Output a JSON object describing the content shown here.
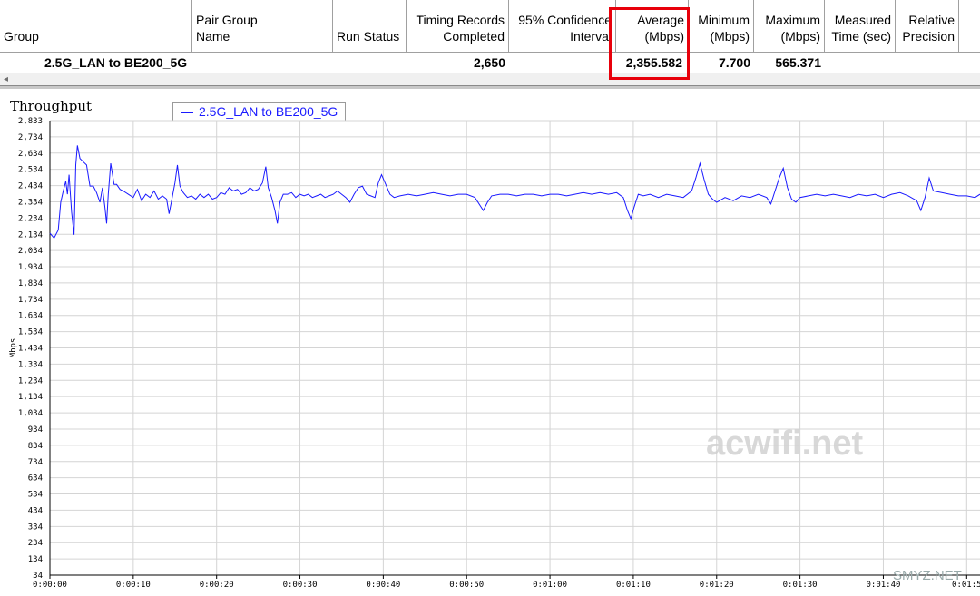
{
  "table": {
    "headers": {
      "group": "Group",
      "pair_group_name": "Pair Group\nName",
      "run_status": "Run Status",
      "timing_records": "Timing Records\nCompleted",
      "confidence": "95% Confidence\nInterval",
      "average": "Average\n(Mbps)",
      "minimum": "Minimum\n(Mbps)",
      "maximum": "Maximum\n(Mbps)",
      "measured_time": "Measured\nTime (sec)",
      "relative_precision": "Relative\nPrecision"
    },
    "row": {
      "group_name": "2.5G_LAN to BE200_5G",
      "timing_records": "2,650",
      "average": "2,355.582",
      "minimum": "7.700",
      "maximum": "565.371"
    },
    "scroll_arrow": "◂"
  },
  "chart_title": "Throughput",
  "legend_label": "2.5G_LAN to BE200_5G",
  "watermark": "acwifi.net",
  "corner_mark": "SMYZ.NET",
  "colors": {
    "series": "#1a1aff",
    "highlight": "#e8000b",
    "grid": "#d4d4d4"
  },
  "chart_data": {
    "type": "line",
    "title": "Throughput",
    "ylabel": "Mbps",
    "xlabel": "",
    "ylim": [
      34,
      2833
    ],
    "yticks": [
      "2,833",
      "2,734",
      "2,634",
      "2,534",
      "2,434",
      "2,334",
      "2,234",
      "2,134",
      "2,034",
      "1,934",
      "1,834",
      "1,734",
      "1,634",
      "1,534",
      "1,434",
      "1,334",
      "1,234",
      "1,134",
      "1,034",
      "934",
      "834",
      "734",
      "634",
      "534",
      "434",
      "334",
      "234",
      "134",
      "34"
    ],
    "xticks": [
      "0:00:00",
      "0:00:10",
      "0:00:20",
      "0:00:30",
      "0:00:40",
      "0:00:50",
      "0:01:00",
      "0:01:10",
      "0:01:20",
      "0:01:30",
      "0:01:40",
      "0:01:5"
    ],
    "xlim_seconds": [
      0,
      111.6
    ],
    "series": [
      {
        "name": "2.5G_LAN to BE200_5G",
        "points": [
          [
            0,
            2140
          ],
          [
            0.5,
            2110
          ],
          [
            1,
            2160
          ],
          [
            1.3,
            2330
          ],
          [
            1.6,
            2400
          ],
          [
            1.9,
            2460
          ],
          [
            2.1,
            2380
          ],
          [
            2.3,
            2500
          ],
          [
            2.6,
            2270
          ],
          [
            2.9,
            2130
          ],
          [
            3.1,
            2560
          ],
          [
            3.3,
            2680
          ],
          [
            3.6,
            2600
          ],
          [
            4,
            2580
          ],
          [
            4.4,
            2560
          ],
          [
            4.8,
            2430
          ],
          [
            5.2,
            2430
          ],
          [
            5.6,
            2390
          ],
          [
            6,
            2330
          ],
          [
            6.3,
            2420
          ],
          [
            6.6,
            2300
          ],
          [
            6.8,
            2200
          ],
          [
            7,
            2380
          ],
          [
            7.3,
            2570
          ],
          [
            7.7,
            2440
          ],
          [
            8,
            2440
          ],
          [
            8.4,
            2410
          ],
          [
            8.8,
            2400
          ],
          [
            9.4,
            2380
          ],
          [
            10,
            2360
          ],
          [
            10.5,
            2410
          ],
          [
            11,
            2340
          ],
          [
            11.5,
            2380
          ],
          [
            12,
            2360
          ],
          [
            12.5,
            2400
          ],
          [
            13,
            2350
          ],
          [
            13.5,
            2370
          ],
          [
            14,
            2350
          ],
          [
            14.3,
            2260
          ],
          [
            14.6,
            2340
          ],
          [
            15,
            2450
          ],
          [
            15.3,
            2560
          ],
          [
            15.6,
            2430
          ],
          [
            16,
            2390
          ],
          [
            16.5,
            2360
          ],
          [
            17,
            2370
          ],
          [
            17.5,
            2350
          ],
          [
            18,
            2380
          ],
          [
            18.5,
            2360
          ],
          [
            19,
            2380
          ],
          [
            19.5,
            2350
          ],
          [
            20,
            2360
          ],
          [
            20.5,
            2390
          ],
          [
            21,
            2380
          ],
          [
            21.5,
            2420
          ],
          [
            22,
            2400
          ],
          [
            22.5,
            2410
          ],
          [
            23,
            2380
          ],
          [
            23.5,
            2390
          ],
          [
            24,
            2420
          ],
          [
            24.5,
            2400
          ],
          [
            25,
            2410
          ],
          [
            25.5,
            2450
          ],
          [
            25.9,
            2550
          ],
          [
            26.2,
            2420
          ],
          [
            26.6,
            2360
          ],
          [
            27,
            2280
          ],
          [
            27.3,
            2200
          ],
          [
            27.6,
            2330
          ],
          [
            28,
            2380
          ],
          [
            28.5,
            2380
          ],
          [
            29,
            2390
          ],
          [
            29.5,
            2360
          ],
          [
            30,
            2380
          ],
          [
            30.5,
            2370
          ],
          [
            31,
            2380
          ],
          [
            31.5,
            2360
          ],
          [
            32,
            2370
          ],
          [
            32.5,
            2380
          ],
          [
            33,
            2360
          ],
          [
            33.5,
            2370
          ],
          [
            34,
            2380
          ],
          [
            34.5,
            2400
          ],
          [
            35,
            2380
          ],
          [
            35.5,
            2360
          ],
          [
            36,
            2330
          ],
          [
            36.5,
            2380
          ],
          [
            37,
            2420
          ],
          [
            37.5,
            2430
          ],
          [
            38,
            2380
          ],
          [
            38.5,
            2370
          ],
          [
            39,
            2360
          ],
          [
            39.4,
            2450
          ],
          [
            39.8,
            2500
          ],
          [
            40.3,
            2440
          ],
          [
            40.8,
            2380
          ],
          [
            41.3,
            2360
          ],
          [
            42,
            2370
          ],
          [
            43,
            2380
          ],
          [
            44,
            2370
          ],
          [
            45,
            2380
          ],
          [
            46,
            2390
          ],
          [
            47,
            2380
          ],
          [
            48,
            2370
          ],
          [
            49,
            2380
          ],
          [
            50,
            2380
          ],
          [
            51,
            2360
          ],
          [
            52,
            2280
          ],
          [
            52.5,
            2330
          ],
          [
            53,
            2370
          ],
          [
            54,
            2380
          ],
          [
            55,
            2380
          ],
          [
            56,
            2370
          ],
          [
            57,
            2380
          ],
          [
            58,
            2380
          ],
          [
            59,
            2370
          ],
          [
            60,
            2380
          ],
          [
            61,
            2380
          ],
          [
            62,
            2370
          ],
          [
            63,
            2380
          ],
          [
            64,
            2390
          ],
          [
            65,
            2380
          ],
          [
            66,
            2390
          ],
          [
            67,
            2380
          ],
          [
            68,
            2390
          ],
          [
            68.8,
            2360
          ],
          [
            69.3,
            2280
          ],
          [
            69.7,
            2230
          ],
          [
            70.1,
            2300
          ],
          [
            70.6,
            2380
          ],
          [
            71.2,
            2370
          ],
          [
            72,
            2380
          ],
          [
            73,
            2360
          ],
          [
            74,
            2380
          ],
          [
            75,
            2370
          ],
          [
            76,
            2360
          ],
          [
            77,
            2400
          ],
          [
            77.5,
            2480
          ],
          [
            78,
            2570
          ],
          [
            78.5,
            2470
          ],
          [
            79,
            2380
          ],
          [
            79.5,
            2350
          ],
          [
            80,
            2330
          ],
          [
            81,
            2360
          ],
          [
            82,
            2340
          ],
          [
            83,
            2370
          ],
          [
            84,
            2360
          ],
          [
            85,
            2380
          ],
          [
            86,
            2360
          ],
          [
            86.5,
            2320
          ],
          [
            87,
            2400
          ],
          [
            87.5,
            2480
          ],
          [
            88,
            2540
          ],
          [
            88.5,
            2420
          ],
          [
            89,
            2350
          ],
          [
            89.5,
            2330
          ],
          [
            90,
            2360
          ],
          [
            91,
            2370
          ],
          [
            92,
            2380
          ],
          [
            93,
            2370
          ],
          [
            94,
            2380
          ],
          [
            95,
            2370
          ],
          [
            96,
            2360
          ],
          [
            97,
            2380
          ],
          [
            98,
            2370
          ],
          [
            99,
            2380
          ],
          [
            100,
            2360
          ],
          [
            101,
            2380
          ],
          [
            102,
            2390
          ],
          [
            103,
            2370
          ],
          [
            104,
            2340
          ],
          [
            104.5,
            2280
          ],
          [
            105,
            2360
          ],
          [
            105.5,
            2480
          ],
          [
            106,
            2400
          ],
          [
            107,
            2390
          ],
          [
            108,
            2380
          ],
          [
            109,
            2370
          ],
          [
            110,
            2370
          ],
          [
            111,
            2360
          ],
          [
            111.6,
            2380
          ]
        ]
      }
    ],
    "grid": true,
    "legend_position": "top-left"
  }
}
